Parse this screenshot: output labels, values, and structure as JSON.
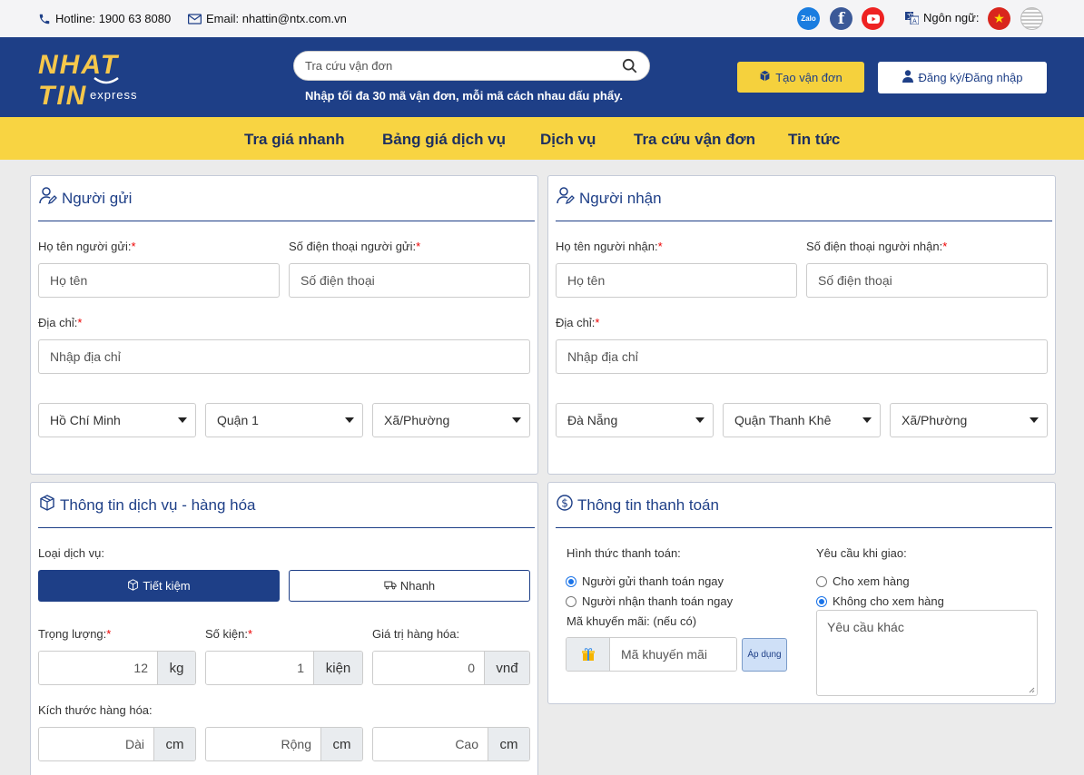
{
  "topbar": {
    "hotline": "Hotline: 1900 63 8080",
    "email": "Email: nhattin@ntx.com.vn",
    "language_label": "Ngôn ngữ:",
    "zalo_text": "Zalo"
  },
  "header": {
    "logo_main": "NHAT TIN",
    "logo_sub": "express",
    "search_placeholder": "Tra cứu vận đơn",
    "search_hint": "Nhập tối đa 30 mã vận đơn, mỗi mã cách nhau dấu phẩy.",
    "create_label": "Tạo vận đơn",
    "login_label": "Đăng ký/Đăng nhập"
  },
  "nav": [
    "Tra giá nhanh",
    "Bảng giá dịch vụ",
    "Dịch vụ",
    "Tra cứu vận đơn",
    "Tin tức"
  ],
  "sender": {
    "title": "Người gửi",
    "name_label": "Họ tên người gửi:",
    "name_placeholder": "Họ tên",
    "phone_label": "Số điện thoại người gửi:",
    "phone_placeholder": "Số điện thoại",
    "address_label": "Địa chỉ:",
    "address_placeholder": "Nhập địa chỉ",
    "province": "Hồ Chí Minh",
    "district": "Quận 1",
    "ward": "Xã/Phường"
  },
  "receiver": {
    "title": "Người nhận",
    "name_label": "Họ tên người nhận:",
    "name_placeholder": "Họ tên",
    "phone_label": "Số điện thoại người nhận:",
    "phone_placeholder": "Số điện thoại",
    "address_label": "Địa chỉ:",
    "address_placeholder": "Nhập địa chỉ",
    "province": "Đà Nẵng",
    "district": "Quận Thanh Khê",
    "ward": "Xã/Phường"
  },
  "service": {
    "title": "Thông tin dịch vụ - hàng hóa",
    "type_label": "Loại dịch vụ:",
    "economy_label": "Tiết kiệm",
    "fast_label": "Nhanh",
    "weight_label": "Trọng lượng:",
    "weight_value": "12",
    "weight_unit": "kg",
    "count_label": "Số kiện:",
    "count_value": "1",
    "count_unit": "kiện",
    "value_label": "Giá trị hàng hóa:",
    "value_value": "0",
    "value_unit": "vnđ",
    "size_label": "Kích thước hàng hóa:",
    "length_placeholder": "Dài",
    "width_placeholder": "Rộng",
    "height_placeholder": "Cao",
    "size_unit": "cm"
  },
  "payment": {
    "title": "Thông tin thanh toán",
    "method_label": "Hình thức thanh toán:",
    "method_options": [
      "Người gửi thanh toán ngay",
      "Người nhận thanh toán ngay"
    ],
    "promo_label": "Mã khuyến mãi: (nếu có)",
    "promo_placeholder": "Mã khuyến mãi",
    "apply_label": "Áp dụng",
    "delivery_label": "Yêu cầu khi giao:",
    "delivery_options": [
      "Cho xem hàng",
      "Không cho xem hàng"
    ],
    "other_placeholder": "Yêu cầu khác"
  },
  "colors": {
    "primary": "#1e3f87",
    "accent": "#f8d442",
    "required": "#e00000"
  }
}
